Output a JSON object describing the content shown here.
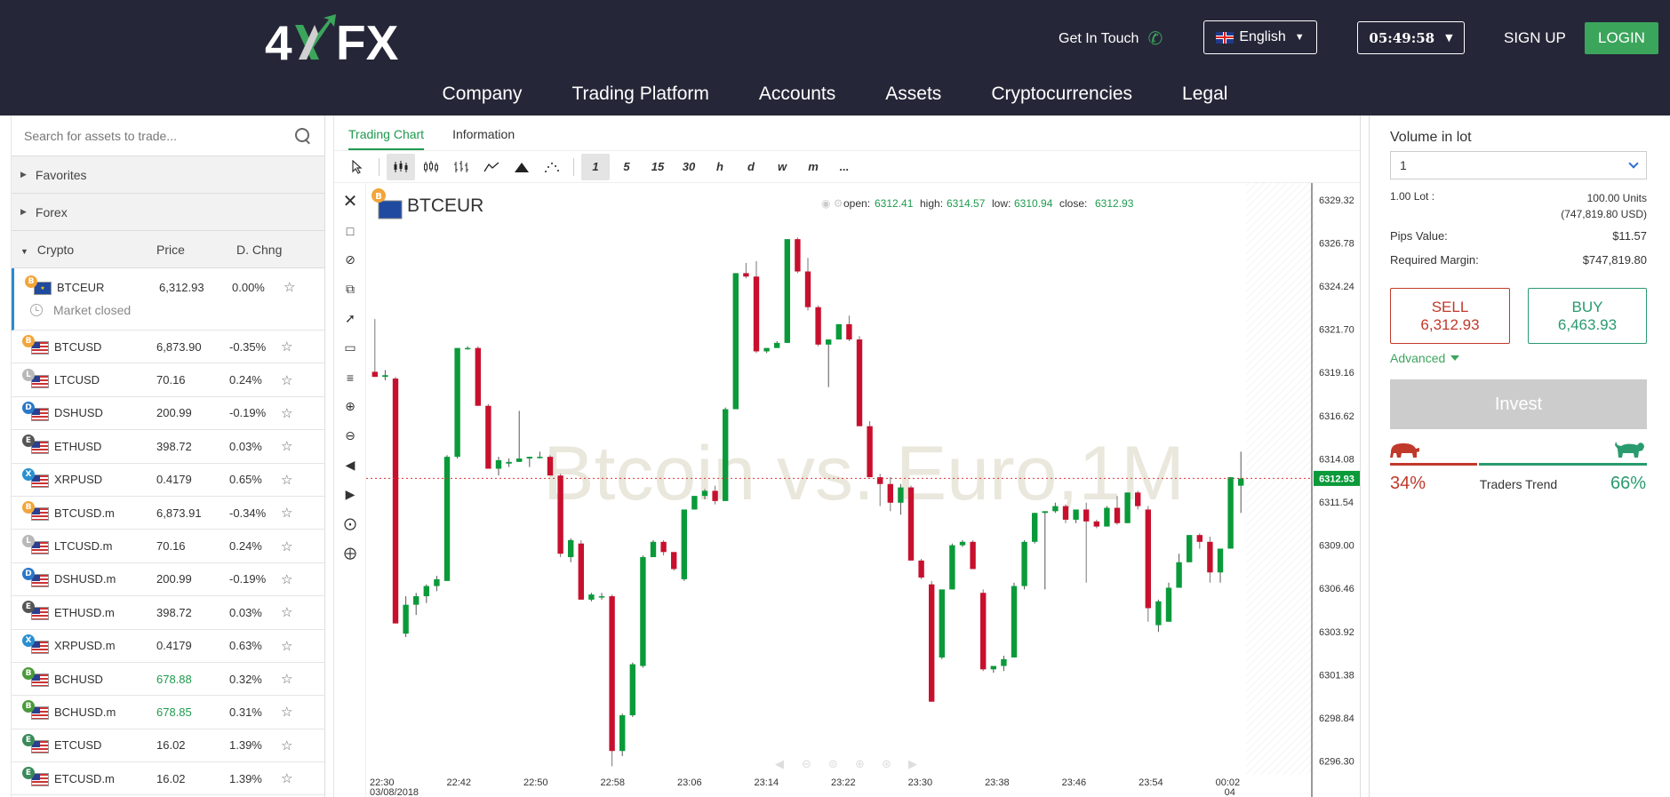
{
  "header": {
    "logo_text": "4XFX",
    "get_in_touch": "Get In Touch",
    "language": "English",
    "clock": "05:49:58",
    "sign_up": "SIGN UP",
    "login": "LOGIN"
  },
  "nav": [
    "Company",
    "Trading Platform",
    "Accounts",
    "Assets",
    "Cryptocurrencies",
    "Legal"
  ],
  "left": {
    "search_placeholder": "Search for assets to trade...",
    "sections": [
      "Favorites",
      "Forex"
    ],
    "crypto": {
      "title": "Crypto",
      "col_price": "Price",
      "col_change": "D. Chng",
      "selected": {
        "symbol": "BTCEUR",
        "price": "6,312.93",
        "change": "0.00%",
        "status": "Market closed",
        "coin_color": "#f2a53a",
        "coin_glyph": "B"
      },
      "rows": [
        {
          "symbol": "BTCUSD",
          "price": "6,873.90",
          "change": "-0.35%",
          "coin_color": "#f2a53a",
          "coin_glyph": "B",
          "up": false
        },
        {
          "symbol": "LTCUSD",
          "price": "70.16",
          "change": "0.24%",
          "coin_color": "#b8b8b8",
          "coin_glyph": "L",
          "up": false
        },
        {
          "symbol": "DSHUSD",
          "price": "200.99",
          "change": "-0.19%",
          "coin_color": "#2a78c8",
          "coin_glyph": "D",
          "up": false
        },
        {
          "symbol": "ETHUSD",
          "price": "398.72",
          "change": "0.03%",
          "coin_color": "#555555",
          "coin_glyph": "E",
          "up": false
        },
        {
          "symbol": "XRPUSD",
          "price": "0.4179",
          "change": "0.65%",
          "coin_color": "#2a8fd1",
          "coin_glyph": "X",
          "up": false
        },
        {
          "symbol": "BTCUSD.m",
          "price": "6,873.91",
          "change": "-0.34%",
          "coin_color": "#f2a53a",
          "coin_glyph": "B",
          "up": false
        },
        {
          "symbol": "LTCUSD.m",
          "price": "70.16",
          "change": "0.24%",
          "coin_color": "#b8b8b8",
          "coin_glyph": "L",
          "up": false
        },
        {
          "symbol": "DSHUSD.m",
          "price": "200.99",
          "change": "-0.19%",
          "coin_color": "#2a78c8",
          "coin_glyph": "D",
          "up": false
        },
        {
          "symbol": "ETHUSD.m",
          "price": "398.72",
          "change": "0.03%",
          "coin_color": "#555555",
          "coin_glyph": "E",
          "up": false
        },
        {
          "symbol": "XRPUSD.m",
          "price": "0.4179",
          "change": "0.63%",
          "coin_color": "#2a8fd1",
          "coin_glyph": "X",
          "up": false
        },
        {
          "symbol": "BCHUSD",
          "price": "678.88",
          "change": "0.32%",
          "coin_color": "#4a9a3a",
          "coin_glyph": "B",
          "up": true
        },
        {
          "symbol": "BCHUSD.m",
          "price": "678.85",
          "change": "0.31%",
          "coin_color": "#4a9a3a",
          "coin_glyph": "B",
          "up": true
        },
        {
          "symbol": "ETCUSD",
          "price": "16.02",
          "change": "1.39%",
          "coin_color": "#3a8a5a",
          "coin_glyph": "E",
          "up": false
        },
        {
          "symbol": "ETCUSD.m",
          "price": "16.02",
          "change": "1.39%",
          "coin_color": "#3a8a5a",
          "coin_glyph": "E",
          "up": false
        }
      ]
    }
  },
  "center": {
    "tabs": [
      "Trading Chart",
      "Information"
    ],
    "timeframes": [
      "1",
      "5",
      "15",
      "30",
      "h",
      "d",
      "w",
      "m",
      "..."
    ],
    "symbol": "BTCEUR",
    "watermark": "Btcoin vs. Euro,1M",
    "ohlc": {
      "open_label": "open:",
      "open": "6312.41",
      "high_label": "high:",
      "high": "6314.57",
      "low_label": "low:",
      "low": "6310.94",
      "close_label": "close:",
      "close": "6312.93"
    },
    "last_price_tag": "6312.93"
  },
  "chart_data": {
    "type": "candlestick",
    "title": "BTCEUR",
    "y_ticks": [
      6329.32,
      6326.78,
      6324.24,
      6321.7,
      6319.16,
      6316.62,
      6314.08,
      6311.54,
      6309.0,
      6306.46,
      6303.92,
      6301.38,
      6298.84,
      6296.3
    ],
    "ylim": [
      6295.5,
      6330.3
    ],
    "x_ticks": [
      "22:30",
      "22:42",
      "22:50",
      "22:58",
      "23:06",
      "23:14",
      "23:22",
      "23:30",
      "23:38",
      "23:46",
      "23:54",
      "00:02"
    ],
    "x_sub_labels": [
      "03/08/2018",
      "",
      "",
      "",
      "",
      "",
      "",
      "",
      "",
      "",
      "",
      "04"
    ],
    "last_price": 6312.93,
    "candles": [
      [
        6319.2,
        6322.3,
        6318.9,
        6318.9
      ],
      [
        6318.9,
        6319.3,
        6318.7,
        6319.0
      ],
      [
        6318.8,
        6318.9,
        6304.4,
        6304.4
      ],
      [
        6303.8,
        6306.0,
        6303.6,
        6305.5
      ],
      [
        6305.5,
        6306.2,
        6304.9,
        6306.0
      ],
      [
        6306.0,
        6306.7,
        6305.6,
        6306.6
      ],
      [
        6306.6,
        6307.2,
        6306.3,
        6307.0
      ],
      [
        6306.9,
        6314.3,
        6306.9,
        6314.2
      ],
      [
        6314.2,
        6320.6,
        6314.1,
        6320.6
      ],
      [
        6320.6,
        6320.7,
        6320.5,
        6320.6
      ],
      [
        6320.6,
        6320.7,
        6317.2,
        6317.2
      ],
      [
        6317.2,
        6317.3,
        6313.5,
        6313.5
      ],
      [
        6313.5,
        6314.2,
        6313.1,
        6314.0
      ],
      [
        6313.8,
        6314.1,
        6313.6,
        6313.9
      ],
      [
        6313.9,
        6316.9,
        6313.9,
        6314.1
      ],
      [
        6314.1,
        6314.2,
        6313.6,
        6314.2
      ],
      [
        6314.2,
        6314.5,
        6314.1,
        6314.2
      ],
      [
        6314.2,
        6314.3,
        6313.1,
        6313.1
      ],
      [
        6313.1,
        6313.2,
        6308.3,
        6308.5
      ],
      [
        6308.3,
        6309.4,
        6308.0,
        6309.3
      ],
      [
        6309.1,
        6309.3,
        6305.8,
        6305.8
      ],
      [
        6305.8,
        6306.2,
        6305.7,
        6306.1
      ],
      [
        6306.0,
        6306.2,
        6305.8,
        6306.0
      ],
      [
        6306.0,
        6306.1,
        6296.0,
        6296.9
      ],
      [
        6296.9,
        6299.1,
        6296.6,
        6299.0
      ],
      [
        6299.0,
        6302.1,
        6298.9,
        6302.0
      ],
      [
        6301.9,
        6308.4,
        6301.8,
        6308.3
      ],
      [
        6308.3,
        6309.3,
        6308.3,
        6309.2
      ],
      [
        6309.2,
        6309.3,
        6308.4,
        6308.6
      ],
      [
        6308.6,
        6308.6,
        6307.5,
        6307.6
      ],
      [
        6307.0,
        6311.1,
        6306.9,
        6311.1
      ],
      [
        6311.1,
        6311.9,
        6311.1,
        6311.9
      ],
      [
        6311.9,
        6312.3,
        6311.7,
        6312.2
      ],
      [
        6312.2,
        6312.5,
        6311.4,
        6311.6
      ],
      [
        6311.6,
        6317.1,
        6311.6,
        6317.0
      ],
      [
        6317.0,
        6325.0,
        6317.0,
        6325.0
      ],
      [
        6325.0,
        6325.6,
        6324.7,
        6324.8
      ],
      [
        6324.8,
        6325.7,
        6320.3,
        6320.4
      ],
      [
        6320.4,
        6320.6,
        6320.3,
        6320.6
      ],
      [
        6320.6,
        6321.0,
        6320.6,
        6320.9
      ],
      [
        6320.9,
        6327.0,
        6320.9,
        6327.0
      ],
      [
        6327.0,
        6327.1,
        6325.0,
        6325.1
      ],
      [
        6325.1,
        6325.9,
        6322.8,
        6323.0
      ],
      [
        6323.0,
        6323.1,
        6320.7,
        6320.8
      ],
      [
        6320.8,
        6321.1,
        6318.3,
        6321.1
      ],
      [
        6321.1,
        6322.0,
        6321.1,
        6322.0
      ],
      [
        6322.0,
        6322.5,
        6321.0,
        6321.1
      ],
      [
        6321.1,
        6321.3,
        6316.0,
        6316.0
      ],
      [
        6316.0,
        6316.3,
        6313.0,
        6313.0
      ],
      [
        6313.0,
        6313.2,
        6311.3,
        6312.6
      ],
      [
        6312.6,
        6313.0,
        6311.0,
        6311.5
      ],
      [
        6311.5,
        6312.6,
        6310.8,
        6312.4
      ],
      [
        6312.4,
        6312.5,
        6308.1,
        6308.1
      ],
      [
        6308.1,
        6308.2,
        6307.0,
        6307.1
      ],
      [
        6306.7,
        6306.9,
        6299.8,
        6299.8
      ],
      [
        6302.4,
        6306.4,
        6302.3,
        6306.4
      ],
      [
        6306.4,
        6309.1,
        6306.4,
        6309.0
      ],
      [
        6309.0,
        6309.3,
        6308.9,
        6309.2
      ],
      [
        6309.2,
        6309.3,
        6307.6,
        6307.6
      ],
      [
        6306.2,
        6306.4,
        6301.6,
        6301.7
      ],
      [
        6301.7,
        6301.9,
        6301.5,
        6301.9
      ],
      [
        6301.9,
        6302.5,
        6301.6,
        6302.3
      ],
      [
        6302.4,
        6306.8,
        6302.4,
        6306.6
      ],
      [
        6306.6,
        6309.3,
        6306.4,
        6309.2
      ],
      [
        6309.2,
        6310.9,
        6309.1,
        6310.9
      ],
      [
        6310.9,
        6311.0,
        6306.4,
        6311.0
      ],
      [
        6311.0,
        6311.5,
        6310.9,
        6311.3
      ],
      [
        6311.3,
        6311.4,
        6310.3,
        6310.5
      ],
      [
        6310.5,
        6311.1,
        6310.3,
        6311.1
      ],
      [
        6311.1,
        6311.5,
        6306.8,
        6310.4
      ],
      [
        6310.4,
        6310.5,
        6310.0,
        6310.1
      ],
      [
        6310.1,
        6311.3,
        6310.1,
        6311.2
      ],
      [
        6311.2,
        6311.9,
        6310.2,
        6310.3
      ],
      [
        6310.3,
        6312.1,
        6310.3,
        6312.1
      ],
      [
        6312.1,
        6312.2,
        6311.1,
        6311.3
      ],
      [
        6311.1,
        6311.3,
        6304.5,
        6305.3
      ],
      [
        6304.3,
        6305.8,
        6303.9,
        6305.7
      ],
      [
        6304.5,
        6306.8,
        6304.5,
        6306.5
      ],
      [
        6306.5,
        6308.5,
        6306.5,
        6308.0
      ],
      [
        6308.0,
        6309.6,
        6308.0,
        6309.6
      ],
      [
        6309.6,
        6309.7,
        6308.8,
        6309.2
      ],
      [
        6309.2,
        6309.5,
        6306.8,
        6307.4
      ],
      [
        6307.4,
        6307.6,
        6306.8,
        6308.8
      ],
      [
        6308.8,
        6313.0,
        6308.8,
        6313.0
      ],
      [
        6312.5,
        6314.5,
        6310.9,
        6312.93
      ]
    ]
  },
  "right": {
    "volume_label": "Volume in lot",
    "volume_value": "1",
    "lot_label": "1.00 Lot :",
    "lot_units": "100.00 Units",
    "lot_usd": "(747,819.80 USD)",
    "pips_label": "Pips Value:",
    "pips_value": "$11.57",
    "margin_label": "Required Margin:",
    "margin_value": "$747,819.80",
    "sell_label": "SELL",
    "sell_price": "6,312.93",
    "buy_label": "BUY",
    "buy_price": "6,463.93",
    "advanced": "Advanced",
    "invest": "Invest",
    "bear_pct": "34%",
    "bull_pct": "66%",
    "bear_fraction": 0.34,
    "trend_label": "Traders Trend"
  },
  "colors": {
    "header_bg": "#252738",
    "accent_green": "#3ca55c",
    "sell_red": "#c0392b",
    "buy_green": "#2a9a6f",
    "candle_up": "#0a9a3a",
    "candle_down": "#c8102e"
  }
}
